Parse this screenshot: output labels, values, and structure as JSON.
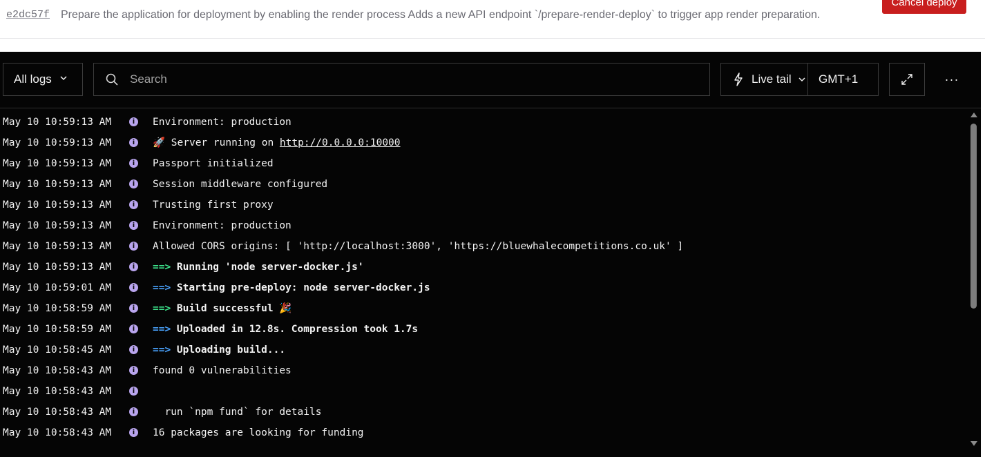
{
  "header": {
    "commit_hash": "e2dc57f",
    "commit_message": "Prepare the application for deployment by enabling the render process Adds a new API endpoint `/prepare-render-deploy` to trigger app render preparation.",
    "cancel_label": "Cancel deploy"
  },
  "toolbar": {
    "filter_label": "All logs",
    "search_placeholder": "Search",
    "live_tail_label": "Live tail",
    "timezone_label": "GMT+1",
    "more_label": "···"
  },
  "icons": {
    "info": "info-icon",
    "search": "search-icon",
    "bolt": "lightning-bolt-icon",
    "expand": "expand-icon",
    "chevron": "chevron-down-icon"
  },
  "colors": {
    "cancel_button": "#c81e1e",
    "arrow_green": "#3ce38b",
    "arrow_blue": "#4aa3ff",
    "info_icon": "#b9a5ee",
    "panel_bg": "#050505"
  },
  "logs": [
    {
      "time": "May 10 10:59:13 AM",
      "pre": "",
      "msg": "Environment: production",
      "link": "",
      "post": ""
    },
    {
      "time": "May 10 10:59:13 AM",
      "pre": "",
      "msg": "🚀 Server running on ",
      "link": "http://0.0.0.0:10000",
      "post": ""
    },
    {
      "time": "May 10 10:59:13 AM",
      "pre": "",
      "msg": "Passport initialized",
      "link": "",
      "post": ""
    },
    {
      "time": "May 10 10:59:13 AM",
      "pre": "",
      "msg": "Session middleware configured",
      "link": "",
      "post": ""
    },
    {
      "time": "May 10 10:59:13 AM",
      "pre": "",
      "msg": "Trusting first proxy",
      "link": "",
      "post": ""
    },
    {
      "time": "May 10 10:59:13 AM",
      "pre": "",
      "msg": "Environment: production",
      "link": "",
      "post": ""
    },
    {
      "time": "May 10 10:59:13 AM",
      "pre": "",
      "msg": "Allowed CORS origins: [ 'http://localhost:3000', 'https://bluewhalecompetitions.co.uk' ]",
      "link": "",
      "post": ""
    },
    {
      "time": "May 10 10:59:13 AM",
      "pre": "==>",
      "pre_color": "green",
      "msg": " Running 'node server-docker.js'",
      "link": "",
      "post": "",
      "bold": true
    },
    {
      "time": "May 10 10:59:01 AM",
      "pre": "==>",
      "pre_color": "blue",
      "msg": " Starting pre-deploy: node server-docker.js",
      "link": "",
      "post": "",
      "bold": true
    },
    {
      "time": "May 10 10:58:59 AM",
      "pre": "==>",
      "pre_color": "green",
      "msg": " Build successful 🎉",
      "link": "",
      "post": "",
      "bold": true
    },
    {
      "time": "May 10 10:58:59 AM",
      "pre": "==>",
      "pre_color": "blue",
      "msg": " Uploaded in 12.8s. Compression took 1.7s",
      "link": "",
      "post": "",
      "bold": true
    },
    {
      "time": "May 10 10:58:45 AM",
      "pre": "==>",
      "pre_color": "blue",
      "msg": " Uploading build...",
      "link": "",
      "post": "",
      "bold": true
    },
    {
      "time": "May 10 10:58:43 AM",
      "pre": "",
      "msg": "found 0 vulnerabilities",
      "link": "",
      "post": ""
    },
    {
      "time": "May 10 10:58:43 AM",
      "pre": "",
      "msg": "",
      "link": "",
      "post": ""
    },
    {
      "time": "May 10 10:58:43 AM",
      "pre": "",
      "msg": "  run `npm fund` for details",
      "link": "",
      "post": ""
    },
    {
      "time": "May 10 10:58:43 AM",
      "pre": "",
      "msg": "16 packages are looking for funding",
      "link": "",
      "post": ""
    }
  ]
}
